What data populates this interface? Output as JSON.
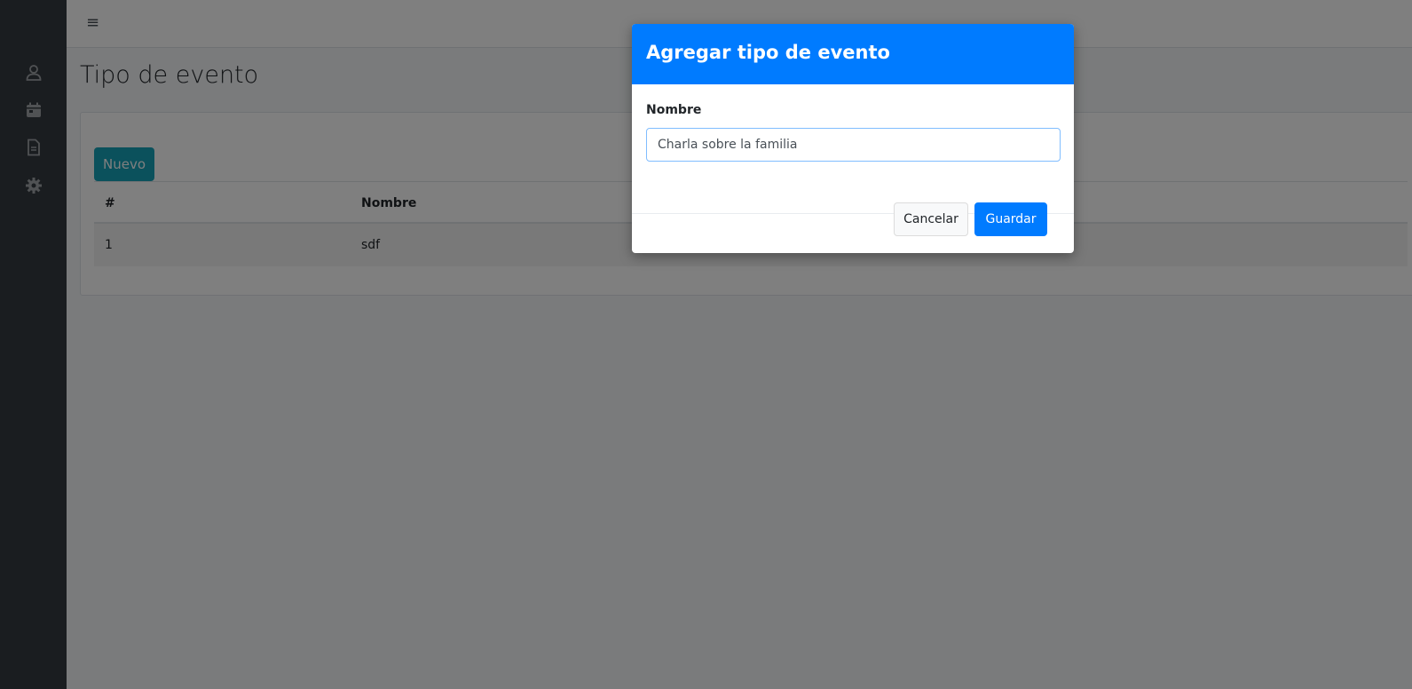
{
  "topbar": {
    "menu_icon": "hamburger-icon",
    "menu_glyph": "≡"
  },
  "sidebar": {
    "items": [
      {
        "icon": "user-icon"
      },
      {
        "icon": "calendar-icon"
      },
      {
        "icon": "document-icon"
      },
      {
        "icon": "gear-icon"
      }
    ]
  },
  "page": {
    "title": "Tipo de evento",
    "new_button": "Nuevo",
    "table": {
      "headers": [
        "#",
        "Nombre"
      ],
      "rows": [
        {
          "id": "1",
          "name": "sdf"
        }
      ]
    }
  },
  "modal": {
    "title": "Agregar tipo de evento",
    "field_label": "Nombre",
    "field_value": "Charla sobre la familia",
    "cancel_label": "Cancelar",
    "save_label": "Guardar"
  },
  "colors": {
    "sidebar": "#343a40",
    "primary": "#007bff",
    "info": "#17a2b8",
    "warning": "#ffc107",
    "danger": "#dc3545"
  }
}
